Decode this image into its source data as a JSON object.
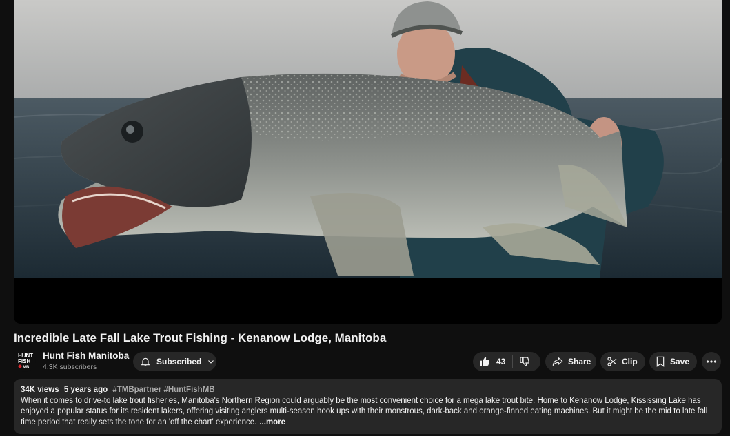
{
  "video": {
    "title": "Incredible Late Fall Lake Trout Fishing - Kenanow Lodge, Manitoba"
  },
  "channel": {
    "name": "Hunt Fish Manitoba",
    "subscribers": "4.3K subscribers",
    "logo_lines": [
      "HUNT",
      "FISH",
      "MB"
    ]
  },
  "actions": {
    "subscribe_label": "Subscribed",
    "like_count": "43",
    "share_label": "Share",
    "clip_label": "Clip",
    "save_label": "Save"
  },
  "description": {
    "views": "34K views",
    "age": "5 years ago",
    "hashtags": [
      "#TMBpartner",
      "#HuntFishMB"
    ],
    "text": "When it comes to drive-to lake trout fisheries, Manitoba's Northern Region could arguably be the most convenient choice for a mega lake trout bite.  Home to Kenanow Lodge, Kississing Lake has enjoyed a popular status for its resident lakers, offering visiting anglers multi-season hook ups with their monstrous, dark-back and orange-finned eating machines. But it might be the mid to late fall time period that really sets the tone for an 'off the chart' experience.",
    "more_label": "...more"
  },
  "icons": [
    "bell-icon",
    "chevron-down-icon",
    "thumbs-up-icon",
    "thumbs-down-icon",
    "share-icon",
    "scissors-icon",
    "bookmark-icon",
    "more-horizontal-icon"
  ],
  "colors": {
    "background": "#0f0f0f",
    "pill": "#272727",
    "text_primary": "#f1f1f1",
    "text_secondary": "#aaaaaa"
  }
}
